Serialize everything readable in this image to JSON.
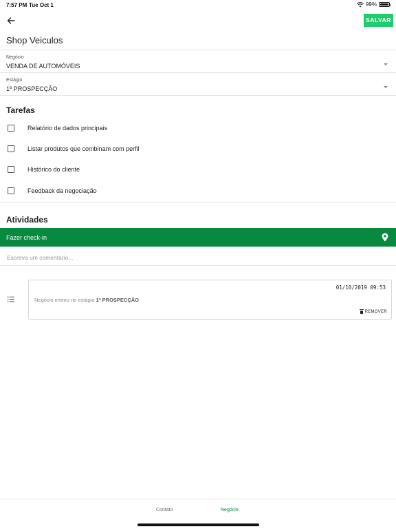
{
  "status_bar": {
    "time": "7:57 PM",
    "date": "Tue Oct 1",
    "battery": "99%",
    "battery_level": 0.99
  },
  "header": {
    "back_icon": "arrow-left-icon",
    "save_label": "SALVAR",
    "title": "Shop Veiculos"
  },
  "fields": {
    "negocio": {
      "label": "Negócio",
      "value": "VENDA DE AUTOMÓVEIS"
    },
    "estagio": {
      "label": "Estágio",
      "value": "1º PROSPECÇÃO"
    }
  },
  "tasks": {
    "title": "Tarefas",
    "items": [
      {
        "label": "Relatório de dados principais",
        "checked": false
      },
      {
        "label": "Listar produtos que combinam com perfil",
        "checked": false
      },
      {
        "label": "Histórico do cliente",
        "checked": false
      },
      {
        "label": "Feedback da negociação",
        "checked": false
      }
    ]
  },
  "activities": {
    "title": "Atividades",
    "checkin_label": "Fazer check-in",
    "checkin_icon": "map-pin-icon",
    "comment_placeholder": "Escreva um comentário...",
    "items": [
      {
        "icon": "list-icon",
        "timestamp": "01/10/2019 09:53",
        "text_prefix": "Negócio entrou no estágio",
        "text_bold": "1º PROSPECÇÃO",
        "remove_label": "REMOVER"
      }
    ]
  },
  "bottom_nav": {
    "tabs": [
      {
        "label": "Contato",
        "active": false
      },
      {
        "label": "Negócio",
        "active": true
      }
    ]
  },
  "colors": {
    "primary_green": "#07893f",
    "save_green": "#1fcc6e"
  }
}
